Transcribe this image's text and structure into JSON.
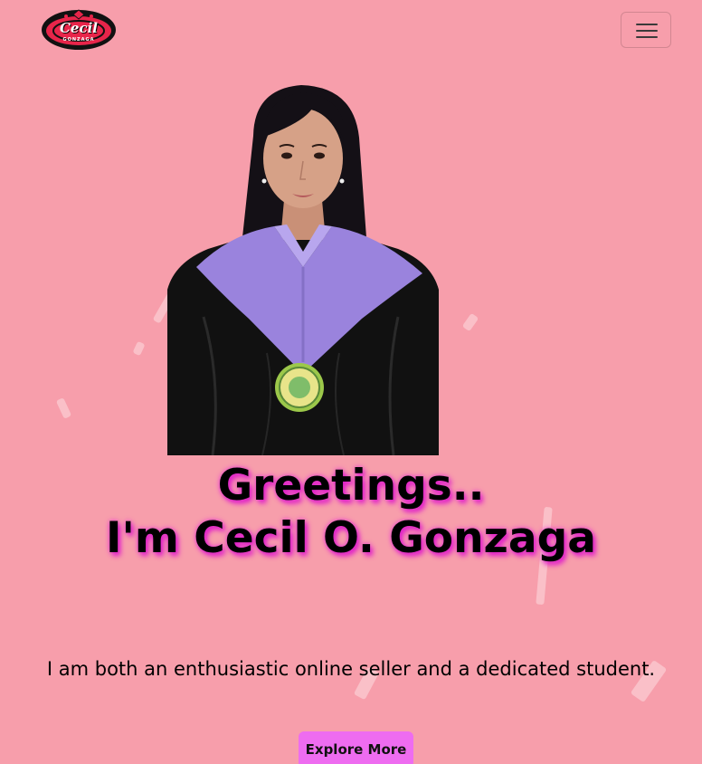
{
  "navbar": {
    "logo_text": "Cecil",
    "logo_subtext": "GONZAGA",
    "menu_icon": "hamburger-menu-icon"
  },
  "hero": {
    "headline_line1": "Greetings..",
    "headline_line2": "I'm Cecil O. Gonzaga",
    "tagline": "I am both an enthusiastic online seller and a dedicated student.",
    "cta_label": "Explore More"
  },
  "colors": {
    "background": "#f79eab",
    "accent_glow": "#e020c8",
    "button": "#ee6cf0",
    "logo_red": "#e8254a"
  }
}
